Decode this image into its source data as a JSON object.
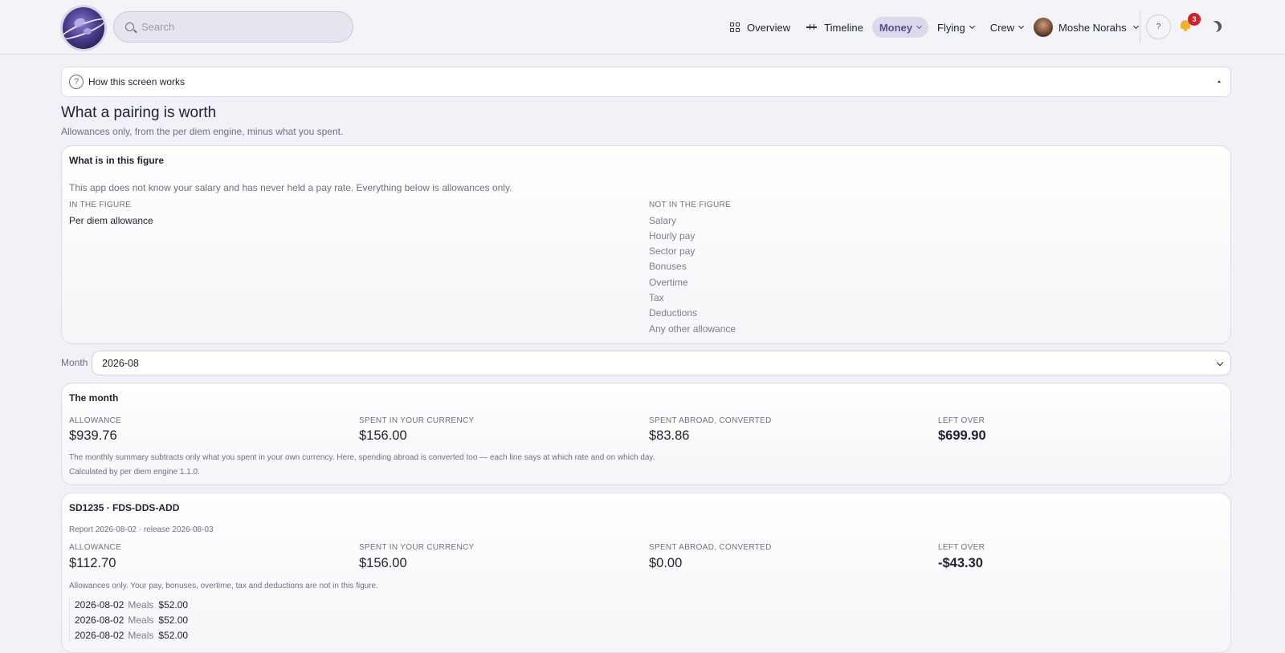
{
  "header": {
    "search_placeholder": "Search",
    "nav": [
      {
        "label": "Overview"
      },
      {
        "label": "Timeline"
      },
      {
        "label": "Money"
      },
      {
        "label": "Flying"
      },
      {
        "label": "Crew"
      }
    ],
    "user_name": "Moshe Norahs",
    "help_label": "?",
    "notification_count": "3"
  },
  "howto": {
    "label": "How this screen works",
    "icon": "?"
  },
  "page": {
    "title": "What a pairing is worth",
    "subtitle": "Allowances only, from the per diem engine, minus what you spent."
  },
  "figure": {
    "title": "What is in this figure",
    "note": "This app does not know your salary and has never held a pay rate. Everything below is allowances only.",
    "in_heading": "IN THE FIGURE",
    "in_items": [
      "Per diem allowance"
    ],
    "out_heading": "NOT IN THE FIGURE",
    "out_items": [
      "Salary",
      "Hourly pay",
      "Sector pay",
      "Bonuses",
      "Overtime",
      "Tax",
      "Deductions",
      "Any other allowance"
    ]
  },
  "month": {
    "label": "Month",
    "value": "2026-08"
  },
  "summary": {
    "title": "The month",
    "labels": [
      "ALLOWANCE",
      "SPENT IN YOUR CURRENCY",
      "SPENT ABROAD, CONVERTED",
      "LEFT OVER"
    ],
    "values": [
      "$939.76",
      "$156.00",
      "$83.86",
      "$699.90"
    ],
    "note1": "The monthly summary subtracts only what you spent in your own currency. Here, spending abroad is converted too — each line says at which rate and on which day.",
    "note2": "Calculated by per diem engine 1.1.0."
  },
  "pairing": {
    "title": "SD1235 · FDS-DDS-ADD",
    "meta": "Report 2026-08-02 · release 2026-08-03",
    "labels": [
      "ALLOWANCE",
      "SPENT IN YOUR CURRENCY",
      "SPENT ABROAD, CONVERTED",
      "LEFT OVER"
    ],
    "values": [
      "$112.70",
      "$156.00",
      "$0.00",
      "-$43.30"
    ],
    "note": "Allowances only. Your pay, bonuses, overtime, tax and deductions are not in this figure.",
    "lines": [
      {
        "date": "2026-08-02",
        "kind": "Meals",
        "amount": "$52.00"
      },
      {
        "date": "2026-08-02",
        "kind": "Meals",
        "amount": "$52.00"
      },
      {
        "date": "2026-08-02",
        "kind": "Meals",
        "amount": "$52.00"
      }
    ]
  }
}
